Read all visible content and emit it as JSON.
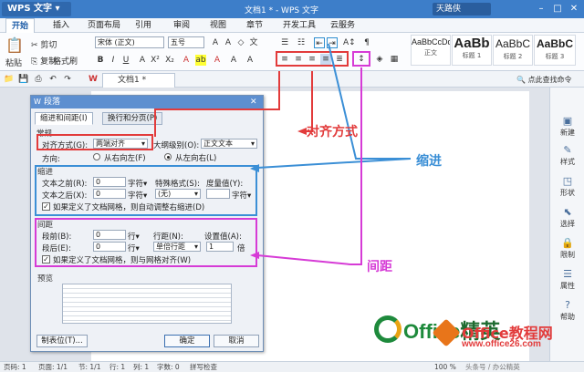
{
  "app": {
    "name": "WPS 文字",
    "window_title": "文档1 * - WPS 文字",
    "user": "天路侠"
  },
  "menu": [
    "开始",
    "插入",
    "页面布局",
    "引用",
    "审阅",
    "视图",
    "章节",
    "开发工具",
    "云服务"
  ],
  "ribbon": {
    "paste": "粘贴",
    "cut": "剪切",
    "copy": "复制",
    "format_painter": "格式刷",
    "font_name": "宋体 (正文)",
    "font_size": "五号",
    "styles": [
      {
        "sample": "AaBbCcDd",
        "name": "正文"
      },
      {
        "sample": "AaBb",
        "name": "标题 1"
      },
      {
        "sample": "AaBbC",
        "name": "标题 2"
      },
      {
        "sample": "AaBbC",
        "name": "标题 3"
      }
    ]
  },
  "quickbar": {
    "tab": "文档1 *",
    "hint": "点此查找命令"
  },
  "sidebar": [
    "新建",
    "样式",
    "形状",
    "选择",
    "限制",
    "属性",
    "帮助"
  ],
  "status": [
    "页码: 1",
    "页面: 1/1",
    "节: 1/1",
    "行: 1",
    "列: 1",
    "字数: 0",
    "拼写检查",
    "100 %"
  ],
  "dialog": {
    "title": "段落",
    "tabs": [
      "缩进和间距(I)",
      "换行和分页(P)"
    ],
    "general": {
      "section": "常规",
      "align_label": "对齐方式(G):",
      "align_value": "两端对齐",
      "outline_label": "大纲级别(O):",
      "outline_value": "正文文本",
      "dir_label": "方向:",
      "rtl": "从右向左(F)",
      "ltr": "从左向右(L)"
    },
    "indent": {
      "section": "缩进",
      "before_label": "文本之前(R):",
      "before_value": "0",
      "before_unit": "字符▾",
      "after_label": "文本之后(X):",
      "after_value": "0",
      "after_unit": "字符▾",
      "special_label": "特殊格式(S):",
      "special_value": "(无)",
      "measure_label": "度量值(Y):",
      "measure_unit": "字符▾",
      "grid_check": "如果定义了文档网格，则自动调整右缩进(D)"
    },
    "spacing": {
      "section": "间距",
      "before_label": "段前(B):",
      "before_value": "0",
      "before_unit": "行▾",
      "after_label": "段后(E):",
      "after_value": "0",
      "after_unit": "行▾",
      "line_label": "行距(N):",
      "line_value": "单倍行距",
      "setting_label": "设置值(A):",
      "setting_value": "1",
      "setting_unit": "倍",
      "grid_check": "如果定义了文档网格，则与网格对齐(W)"
    },
    "preview": "预览",
    "tabs_button": "制表位(T)...",
    "ok": "确定",
    "cancel": "取消"
  },
  "annotations": {
    "align": "对齐方式",
    "indent": "缩进",
    "spacing": "间距"
  },
  "logo": {
    "text": "Office",
    "suffix": "精英",
    "badge": "Office教程网",
    "url": "www.office26.com",
    "watermark": "头条号 / 办公精英"
  },
  "colors": {
    "red": "#e23b3b",
    "blue": "#3b8fd6",
    "magenta": "#d63bd6",
    "titlebar": "#3d7ec9"
  }
}
